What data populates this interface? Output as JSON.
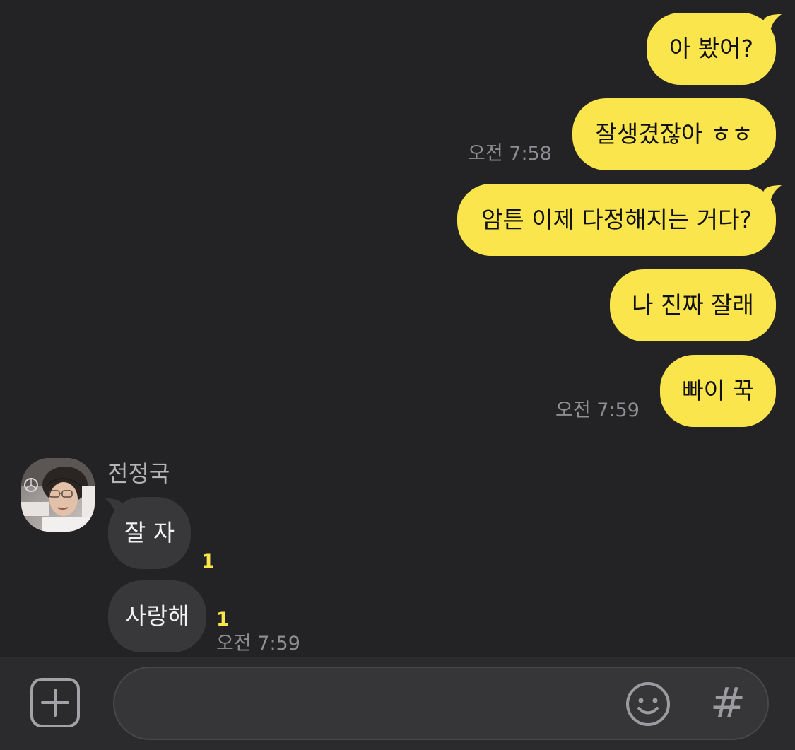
{
  "sent_messages": [
    {
      "text": "아 봤어?"
    },
    {
      "text": "잘생겼잖아 ㅎㅎ"
    },
    {
      "text": "암튼 이제 다정해지는 거다?"
    },
    {
      "text": "나 진짜 잘래"
    },
    {
      "text": "빠이 꾹"
    }
  ],
  "sent_times": [
    "오전 7:58",
    "오전 7:59"
  ],
  "contact": {
    "name": "전정국"
  },
  "received_messages": [
    {
      "text": "잘 자",
      "unread": "1"
    },
    {
      "text": "사랑해",
      "unread": "1"
    }
  ],
  "received_time": "오전 7:59",
  "input": {
    "value": "",
    "placeholder": ""
  },
  "icons": {
    "attach": "plus-square-icon",
    "emoji": "smiley-icon",
    "hashtag": "hash-icon"
  },
  "hashtag_glyph": "#",
  "colors": {
    "background": "#232325",
    "my_bubble": "#FAE54C",
    "their_bubble": "#38383A",
    "unread_count": "#FAE54C"
  }
}
